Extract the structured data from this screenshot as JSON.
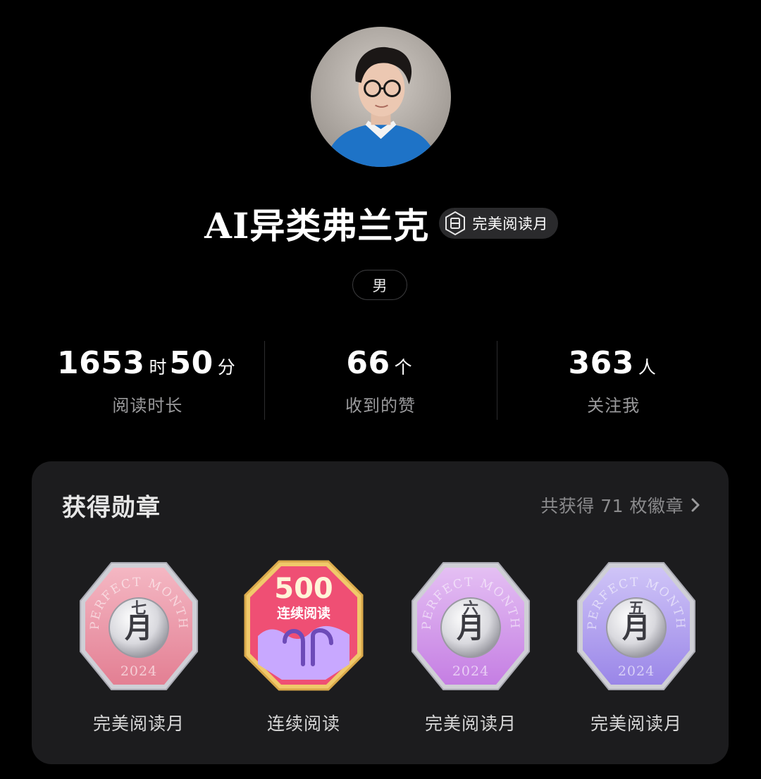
{
  "profile": {
    "username": "AI异类弗兰克",
    "title_badge": "完美阅读月",
    "title_badge_icon": "hexagon-book-icon",
    "gender": "男"
  },
  "stats": [
    {
      "parts": [
        {
          "num": "1653",
          "unit": "时"
        },
        {
          "num": "50",
          "unit": "分"
        }
      ],
      "label": "阅读时长"
    },
    {
      "parts": [
        {
          "num": "66",
          "unit": "个"
        }
      ],
      "label": "收到的赞"
    },
    {
      "parts": [
        {
          "num": "363",
          "unit": "人"
        }
      ],
      "label": "关注我"
    }
  ],
  "medals_card": {
    "title": "获得勋章",
    "summary": "共获得 71 枚徽章",
    "chevron_icon": "chevron-right-icon",
    "medals": [
      {
        "label": "完美阅读月",
        "kind": "perfect-month",
        "arc_text": "PERFECT MONTH",
        "year": "2024",
        "month_char": "七月",
        "color": "#e37f93",
        "color_light": "#f4b7c3"
      },
      {
        "label": "连续阅读",
        "kind": "streak",
        "number": "500",
        "caption": "连续阅读",
        "color": "#ef4f74",
        "color_light": "#c8a8ff"
      },
      {
        "label": "完美阅读月",
        "kind": "perfect-month",
        "arc_text": "PERFECT MONTH",
        "year": "2024",
        "month_char": "六月",
        "color": "#c57ee3",
        "color_light": "#e4bff3"
      },
      {
        "label": "完美阅读月",
        "kind": "perfect-month",
        "arc_text": "PERFECT MONTH",
        "year": "2024",
        "month_char": "五月",
        "color": "#9a86e8",
        "color_light": "#cfc4f7"
      }
    ]
  },
  "colors": {
    "background": "#000000",
    "card": "#1c1c1e",
    "secondary_text": "#9a9a9c"
  }
}
